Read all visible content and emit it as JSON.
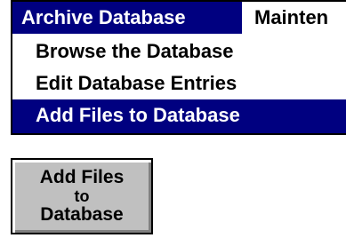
{
  "menubar": {
    "active_title": "Archive Database",
    "next_title": "Mainten"
  },
  "dropdown": {
    "items": [
      {
        "label": "Browse the Database"
      },
      {
        "label": "Edit Database Entries"
      },
      {
        "label": "Add Files to Database"
      }
    ]
  },
  "button": {
    "line1": "Add Files",
    "line2": "to",
    "line3": "Database"
  },
  "colors": {
    "highlight": "#000080",
    "button_face": "#c0c0c0"
  }
}
